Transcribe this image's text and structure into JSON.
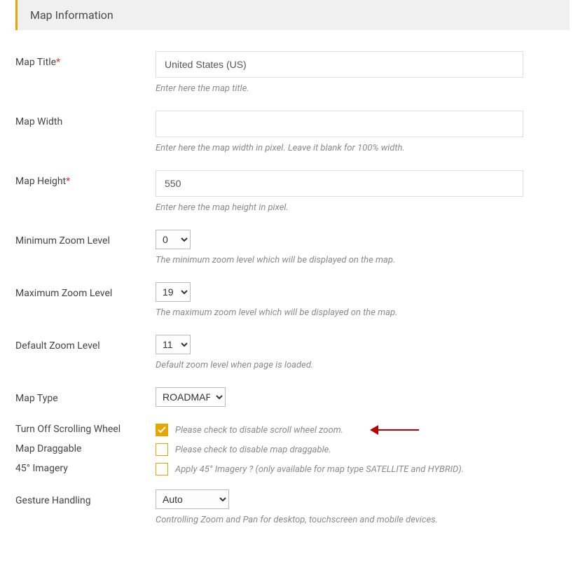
{
  "panel": {
    "title": "Map Information"
  },
  "fields": {
    "map_title": {
      "label": "Map Title",
      "value": "United States (US)",
      "help": "Enter here the map title."
    },
    "map_width": {
      "label": "Map Width",
      "value": "",
      "help": "Enter here the map width in pixel. Leave it blank for 100% width."
    },
    "map_height": {
      "label": "Map Height",
      "value": "550",
      "help": "Enter here the map height in pixel."
    },
    "min_zoom": {
      "label": "Minimum Zoom Level",
      "value": "0",
      "help": "The minimum zoom level which will be displayed on the map."
    },
    "max_zoom": {
      "label": "Maximum Zoom Level",
      "value": "19",
      "help": "The maximum zoom level which will be displayed on the map."
    },
    "default_zoom": {
      "label": "Default Zoom Level",
      "value": "11",
      "help": "Default zoom level when page is loaded."
    },
    "map_type": {
      "label": "Map Type",
      "value": "ROADMAP"
    },
    "scroll_off": {
      "label": "Turn Off Scrolling Wheel",
      "checked": true,
      "desc": "Please check to disable scroll wheel zoom."
    },
    "draggable": {
      "label": "Map Draggable",
      "checked": false,
      "desc": "Please check to disable map draggable."
    },
    "imagery45": {
      "label": "45° Imagery",
      "checked": false,
      "desc": "Apply 45° Imagery ? (only available for map type SATELLITE and HYBRID)."
    },
    "gesture": {
      "label": "Gesture Handling",
      "value": "Auto",
      "help": "Controlling Zoom and Pan for desktop, touchscreen and mobile devices."
    }
  }
}
